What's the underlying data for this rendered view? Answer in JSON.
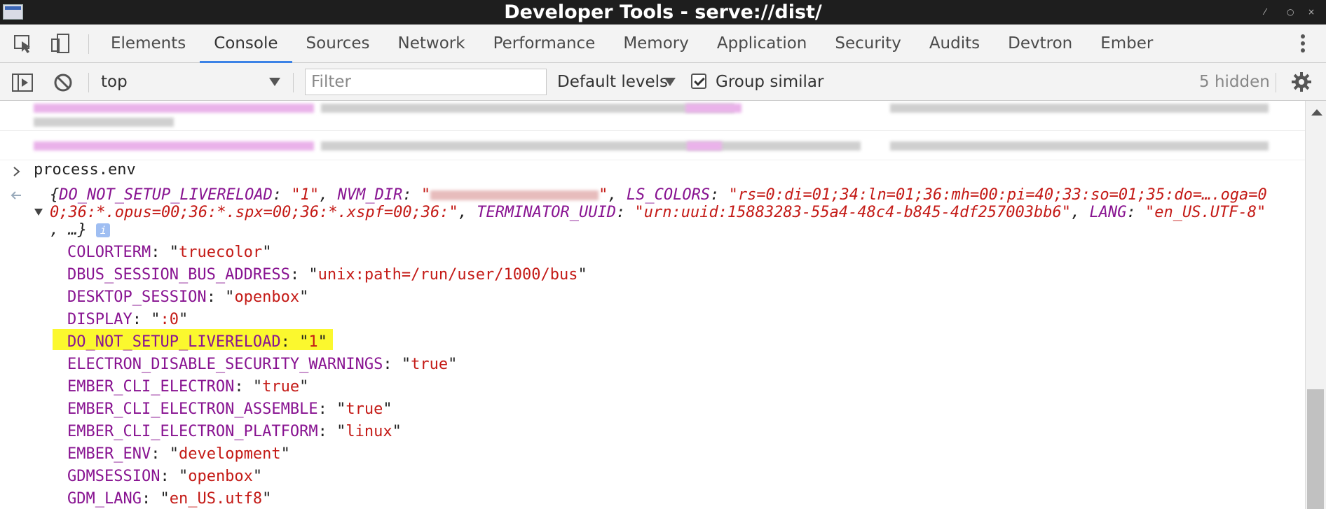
{
  "window": {
    "title": "Developer Tools - serve://dist/"
  },
  "tabs": [
    "Elements",
    "Console",
    "Sources",
    "Network",
    "Performance",
    "Memory",
    "Application",
    "Security",
    "Audits",
    "Devtron",
    "Ember"
  ],
  "active_tab": "Console",
  "toolbar": {
    "context": "top",
    "filter_placeholder": "Filter",
    "levels": "Default levels",
    "group_similar": "Group similar",
    "hidden_count": "5 hidden"
  },
  "console": {
    "input_command": "process.env",
    "summary": {
      "k1": "DO_NOT_SETUP_LIVERELOAD",
      "v1": "\"1\"",
      "k2": "NVM_DIR",
      "k3": "LS_COLORS",
      "v3a": "\"rs=0:di=01;34:ln=01;36:mh=00:pi=40;33:so=01;35:do=….oga=0",
      "v3b": "0;36:*.opus=00;36:*.spx=00;36:*.xspf=00;36:\"",
      "k4": "TERMINATOR_UUID",
      "v4": "\"urn:uuid:15883283-55a4-48c4-b845-4df257003bb6\"",
      "k5": "LANG",
      "v5": "\"en_US.UTF-8\"",
      "tail": ", …}"
    },
    "entries": [
      {
        "key": "COLORTERM",
        "value": "truecolor"
      },
      {
        "key": "DBUS_SESSION_BUS_ADDRESS",
        "value": "unix:path=/run/user/1000/bus"
      },
      {
        "key": "DESKTOP_SESSION",
        "value": "openbox"
      },
      {
        "key": "DISPLAY",
        "value": ":0"
      },
      {
        "key": "DO_NOT_SETUP_LIVERELOAD",
        "value": "1",
        "highlighted": true
      },
      {
        "key": "ELECTRON_DISABLE_SECURITY_WARNINGS",
        "value": "true"
      },
      {
        "key": "EMBER_CLI_ELECTRON",
        "value": "true"
      },
      {
        "key": "EMBER_CLI_ELECTRON_ASSEMBLE",
        "value": "true"
      },
      {
        "key": "EMBER_CLI_ELECTRON_PLATFORM",
        "value": "linux"
      },
      {
        "key": "EMBER_ENV",
        "value": "development"
      },
      {
        "key": "GDMSESSION",
        "value": "openbox"
      },
      {
        "key": "GDM_LANG",
        "value": "en_US.utf8"
      }
    ]
  },
  "colors": {
    "key": "#881391",
    "string": "#c41a16",
    "highlight": "#fbf82e",
    "tab_underline": "#3b82e6"
  }
}
